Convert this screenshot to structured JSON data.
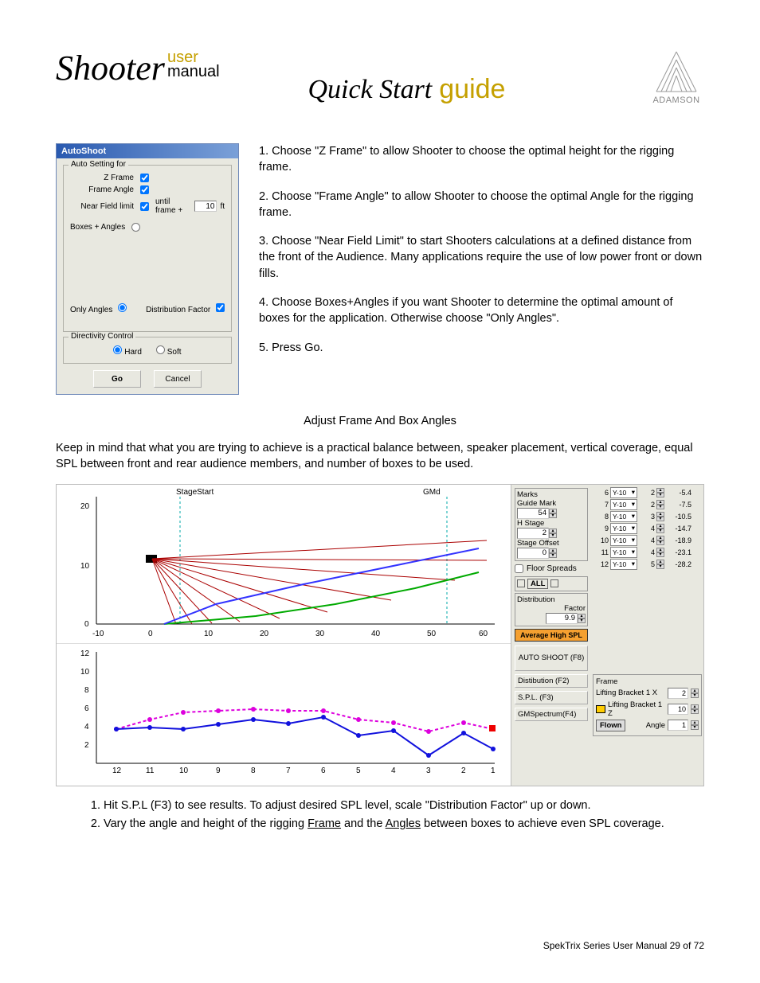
{
  "header": {
    "product": "Shooter",
    "subtitle_top": "user",
    "subtitle_bot": "manual",
    "title_script": "Quick Start",
    "title_guide": "guide",
    "brand": "ADAMSON"
  },
  "autoshoot": {
    "title": "AutoShoot",
    "legend1": "Auto Setting for",
    "zframe": "Z Frame",
    "frameangle": "Frame Angle",
    "nearfield": "Near Field limit",
    "untilframe": "until frame +",
    "nearfield_val": "10",
    "nearfield_unit": "ft",
    "boxesangles": "Boxes + Angles",
    "onlyangles": "Only Angles",
    "distfactor": "Distribution Factor",
    "legend2": "Directivity Control",
    "hard": "Hard",
    "soft": "Soft",
    "go": "Go",
    "cancel": "Cancel"
  },
  "instructions": {
    "i1": "1.  Choose \"Z Frame\" to allow Shooter to choose the optimal height for the rigging frame.",
    "i2": "2.  Choose \"Frame Angle\" to allow Shooter to choose the optimal Angle for the rigging frame.",
    "i3": "3.  Choose \"Near Field Limit\" to start Shooters calculations at a defined distance from the front of the Audience. Many applications require the use of low power front or down fills.",
    "i4": "4.  Choose Boxes+Angles if you want Shooter to determine the optimal amount of boxes for the application. Otherwise choose \"Only Angles\".",
    "i5": "5.  Press Go."
  },
  "subhead": "Adjust Frame And Box Angles",
  "keep": "Keep in mind that what you are trying to achieve is a practical balance between, speaker placement, vertical coverage, equal SPL between front and rear audience members, and number of boxes to be used.",
  "chart_data": [
    {
      "type": "line",
      "title": "",
      "annotations": [
        "StageStart",
        "GMd"
      ],
      "xlabel": "",
      "ylabel": "",
      "xlim": [
        -10,
        60
      ],
      "ylim": [
        0,
        22
      ],
      "x_ticks": [
        -10,
        0,
        10,
        20,
        30,
        40,
        50,
        60
      ],
      "y_ticks": [
        0,
        10,
        20
      ],
      "description": "Side-view ray fan of speaker coverage from rigging point near (0,12) spreading to audience plane, with green audience line rising from ~ (2,0) to (55,7)."
    },
    {
      "type": "line",
      "title": "",
      "xlabel": "",
      "ylabel": "",
      "x_ticks": [
        12,
        11,
        10,
        9,
        8,
        7,
        6,
        5,
        4,
        3,
        2,
        1
      ],
      "y_ticks": [
        0,
        2,
        4,
        6,
        8,
        10,
        12
      ],
      "series": [
        {
          "name": "magenta-dotted",
          "x": [
            12,
            11,
            10,
            9,
            8,
            7,
            6,
            5,
            4,
            3,
            2,
            1
          ],
          "y": [
            4,
            5,
            5.8,
            6,
            6.2,
            6,
            6,
            5,
            4.7,
            3.8,
            4.7,
            4
          ]
        },
        {
          "name": "blue-solid",
          "x": [
            12,
            11,
            10,
            9,
            8,
            7,
            6,
            5,
            4,
            3,
            2,
            1
          ],
          "y": [
            4,
            4.2,
            4,
            4.5,
            5,
            4.6,
            5.2,
            3,
            3.6,
            1,
            3.5,
            1.8
          ]
        }
      ]
    }
  ],
  "midpanel": {
    "marks": "Marks",
    "guidemark": "Guide Mark",
    "guidemark_val": "54",
    "hstage": "H Stage",
    "hstage_val": "2",
    "stageoffset": "Stage Offset",
    "stageoffset_val": "0",
    "floorspreads": "Floor Spreads",
    "all": "ALL",
    "distribution": "Distribution",
    "factor": "Factor",
    "distfactor_val": "9.9",
    "avghigh": "Average High SPL",
    "autoshoot": "AUTO SHOOT (F8)",
    "dist_btn": "Distibution (F2)",
    "spl_btn": "S.P.L. (F3)",
    "gm_btn": "GMSpectrum(F4)"
  },
  "boxtable": {
    "rows": [
      {
        "n": "6",
        "model": "Y-10",
        "v": "2",
        "ang": "-5.4"
      },
      {
        "n": "7",
        "model": "Y-10",
        "v": "2",
        "ang": "-7.5"
      },
      {
        "n": "8",
        "model": "Y-10",
        "v": "3",
        "ang": "-10.5"
      },
      {
        "n": "9",
        "model": "Y-10",
        "v": "4",
        "ang": "-14.7"
      },
      {
        "n": "10",
        "model": "Y-10",
        "v": "4",
        "ang": "-18.9"
      },
      {
        "n": "11",
        "model": "Y-10",
        "v": "4",
        "ang": "-23.1"
      },
      {
        "n": "12",
        "model": "Y-10",
        "v": "5",
        "ang": "-28.2"
      }
    ]
  },
  "frame": {
    "legend": "Frame",
    "lb1x": "Lifting Bracket 1 X",
    "lb1x_val": "2",
    "lb1z": "Lifting Bracket 1 Z",
    "lb1z_val": "10",
    "flown": "Flown",
    "angle": "Angle",
    "angle_val": "1"
  },
  "bottomlist": {
    "l1a": "Hit S.P.L (F3) to see results. To adjust desired SPL level, scale \"Distribution Factor\" up or down.",
    "l2a": "Vary the angle and height of the rigging ",
    "l2b": "Frame",
    "l2c": " and the ",
    "l2d": "Angles",
    "l2e": " between boxes to achieve even SPL coverage."
  },
  "footer": "SpekTrix Series User Manual  29 of 72"
}
